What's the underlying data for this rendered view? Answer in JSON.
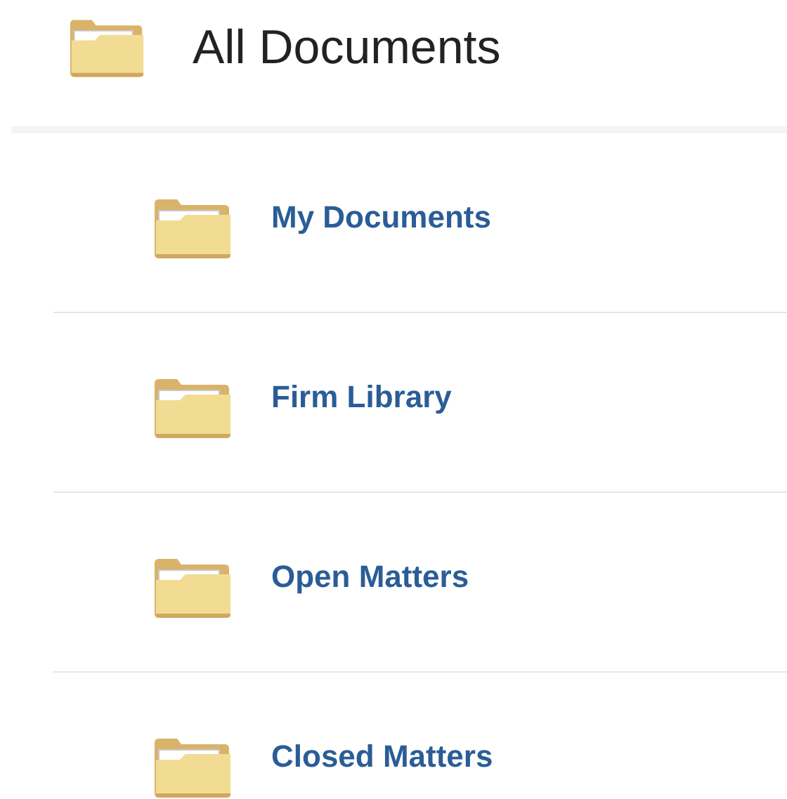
{
  "header": {
    "title": "All Documents"
  },
  "folders": [
    {
      "name": "My Documents"
    },
    {
      "name": "Firm Library"
    },
    {
      "name": "Open Matters"
    },
    {
      "name": "Closed Matters"
    }
  ]
}
